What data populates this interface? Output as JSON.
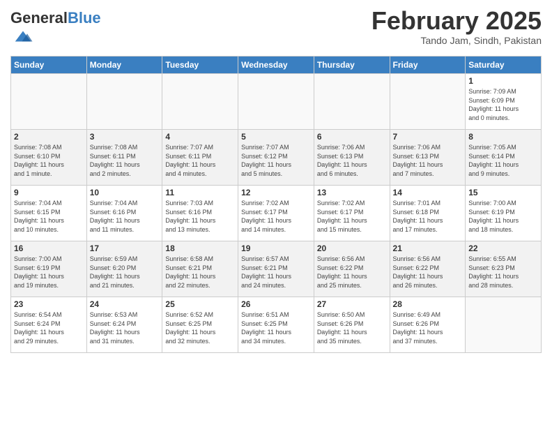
{
  "header": {
    "logo_general": "General",
    "logo_blue": "Blue",
    "month": "February 2025",
    "location": "Tando Jam, Sindh, Pakistan"
  },
  "days_of_week": [
    "Sunday",
    "Monday",
    "Tuesday",
    "Wednesday",
    "Thursday",
    "Friday",
    "Saturday"
  ],
  "weeks": [
    [
      {
        "day": "",
        "info": ""
      },
      {
        "day": "",
        "info": ""
      },
      {
        "day": "",
        "info": ""
      },
      {
        "day": "",
        "info": ""
      },
      {
        "day": "",
        "info": ""
      },
      {
        "day": "",
        "info": ""
      },
      {
        "day": "1",
        "info": "Sunrise: 7:09 AM\nSunset: 6:09 PM\nDaylight: 11 hours\nand 0 minutes."
      }
    ],
    [
      {
        "day": "2",
        "info": "Sunrise: 7:08 AM\nSunset: 6:10 PM\nDaylight: 11 hours\nand 1 minute."
      },
      {
        "day": "3",
        "info": "Sunrise: 7:08 AM\nSunset: 6:11 PM\nDaylight: 11 hours\nand 2 minutes."
      },
      {
        "day": "4",
        "info": "Sunrise: 7:07 AM\nSunset: 6:11 PM\nDaylight: 11 hours\nand 4 minutes."
      },
      {
        "day": "5",
        "info": "Sunrise: 7:07 AM\nSunset: 6:12 PM\nDaylight: 11 hours\nand 5 minutes."
      },
      {
        "day": "6",
        "info": "Sunrise: 7:06 AM\nSunset: 6:13 PM\nDaylight: 11 hours\nand 6 minutes."
      },
      {
        "day": "7",
        "info": "Sunrise: 7:06 AM\nSunset: 6:13 PM\nDaylight: 11 hours\nand 7 minutes."
      },
      {
        "day": "8",
        "info": "Sunrise: 7:05 AM\nSunset: 6:14 PM\nDaylight: 11 hours\nand 9 minutes."
      }
    ],
    [
      {
        "day": "9",
        "info": "Sunrise: 7:04 AM\nSunset: 6:15 PM\nDaylight: 11 hours\nand 10 minutes."
      },
      {
        "day": "10",
        "info": "Sunrise: 7:04 AM\nSunset: 6:16 PM\nDaylight: 11 hours\nand 11 minutes."
      },
      {
        "day": "11",
        "info": "Sunrise: 7:03 AM\nSunset: 6:16 PM\nDaylight: 11 hours\nand 13 minutes."
      },
      {
        "day": "12",
        "info": "Sunrise: 7:02 AM\nSunset: 6:17 PM\nDaylight: 11 hours\nand 14 minutes."
      },
      {
        "day": "13",
        "info": "Sunrise: 7:02 AM\nSunset: 6:17 PM\nDaylight: 11 hours\nand 15 minutes."
      },
      {
        "day": "14",
        "info": "Sunrise: 7:01 AM\nSunset: 6:18 PM\nDaylight: 11 hours\nand 17 minutes."
      },
      {
        "day": "15",
        "info": "Sunrise: 7:00 AM\nSunset: 6:19 PM\nDaylight: 11 hours\nand 18 minutes."
      }
    ],
    [
      {
        "day": "16",
        "info": "Sunrise: 7:00 AM\nSunset: 6:19 PM\nDaylight: 11 hours\nand 19 minutes."
      },
      {
        "day": "17",
        "info": "Sunrise: 6:59 AM\nSunset: 6:20 PM\nDaylight: 11 hours\nand 21 minutes."
      },
      {
        "day": "18",
        "info": "Sunrise: 6:58 AM\nSunset: 6:21 PM\nDaylight: 11 hours\nand 22 minutes."
      },
      {
        "day": "19",
        "info": "Sunrise: 6:57 AM\nSunset: 6:21 PM\nDaylight: 11 hours\nand 24 minutes."
      },
      {
        "day": "20",
        "info": "Sunrise: 6:56 AM\nSunset: 6:22 PM\nDaylight: 11 hours\nand 25 minutes."
      },
      {
        "day": "21",
        "info": "Sunrise: 6:56 AM\nSunset: 6:22 PM\nDaylight: 11 hours\nand 26 minutes."
      },
      {
        "day": "22",
        "info": "Sunrise: 6:55 AM\nSunset: 6:23 PM\nDaylight: 11 hours\nand 28 minutes."
      }
    ],
    [
      {
        "day": "23",
        "info": "Sunrise: 6:54 AM\nSunset: 6:24 PM\nDaylight: 11 hours\nand 29 minutes."
      },
      {
        "day": "24",
        "info": "Sunrise: 6:53 AM\nSunset: 6:24 PM\nDaylight: 11 hours\nand 31 minutes."
      },
      {
        "day": "25",
        "info": "Sunrise: 6:52 AM\nSunset: 6:25 PM\nDaylight: 11 hours\nand 32 minutes."
      },
      {
        "day": "26",
        "info": "Sunrise: 6:51 AM\nSunset: 6:25 PM\nDaylight: 11 hours\nand 34 minutes."
      },
      {
        "day": "27",
        "info": "Sunrise: 6:50 AM\nSunset: 6:26 PM\nDaylight: 11 hours\nand 35 minutes."
      },
      {
        "day": "28",
        "info": "Sunrise: 6:49 AM\nSunset: 6:26 PM\nDaylight: 11 hours\nand 37 minutes."
      },
      {
        "day": "",
        "info": ""
      }
    ]
  ]
}
